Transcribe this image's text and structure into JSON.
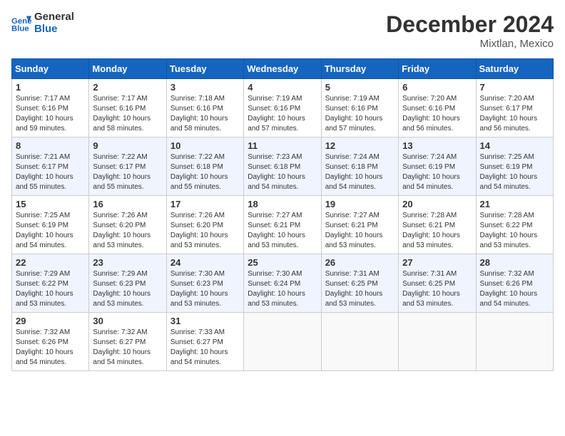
{
  "header": {
    "logo_line1": "General",
    "logo_line2": "Blue",
    "month": "December 2024",
    "location": "Mixtlan, Mexico"
  },
  "weekdays": [
    "Sunday",
    "Monday",
    "Tuesday",
    "Wednesday",
    "Thursday",
    "Friday",
    "Saturday"
  ],
  "weeks": [
    [
      {
        "day": "1",
        "sunrise": "7:17 AM",
        "sunset": "6:16 PM",
        "daylight": "10 hours and 59 minutes."
      },
      {
        "day": "2",
        "sunrise": "7:17 AM",
        "sunset": "6:16 PM",
        "daylight": "10 hours and 58 minutes."
      },
      {
        "day": "3",
        "sunrise": "7:18 AM",
        "sunset": "6:16 PM",
        "daylight": "10 hours and 58 minutes."
      },
      {
        "day": "4",
        "sunrise": "7:19 AM",
        "sunset": "6:16 PM",
        "daylight": "10 hours and 57 minutes."
      },
      {
        "day": "5",
        "sunrise": "7:19 AM",
        "sunset": "6:16 PM",
        "daylight": "10 hours and 57 minutes."
      },
      {
        "day": "6",
        "sunrise": "7:20 AM",
        "sunset": "6:16 PM",
        "daylight": "10 hours and 56 minutes."
      },
      {
        "day": "7",
        "sunrise": "7:20 AM",
        "sunset": "6:17 PM",
        "daylight": "10 hours and 56 minutes."
      }
    ],
    [
      {
        "day": "8",
        "sunrise": "7:21 AM",
        "sunset": "6:17 PM",
        "daylight": "10 hours and 55 minutes."
      },
      {
        "day": "9",
        "sunrise": "7:22 AM",
        "sunset": "6:17 PM",
        "daylight": "10 hours and 55 minutes."
      },
      {
        "day": "10",
        "sunrise": "7:22 AM",
        "sunset": "6:18 PM",
        "daylight": "10 hours and 55 minutes."
      },
      {
        "day": "11",
        "sunrise": "7:23 AM",
        "sunset": "6:18 PM",
        "daylight": "10 hours and 54 minutes."
      },
      {
        "day": "12",
        "sunrise": "7:24 AM",
        "sunset": "6:18 PM",
        "daylight": "10 hours and 54 minutes."
      },
      {
        "day": "13",
        "sunrise": "7:24 AM",
        "sunset": "6:19 PM",
        "daylight": "10 hours and 54 minutes."
      },
      {
        "day": "14",
        "sunrise": "7:25 AM",
        "sunset": "6:19 PM",
        "daylight": "10 hours and 54 minutes."
      }
    ],
    [
      {
        "day": "15",
        "sunrise": "7:25 AM",
        "sunset": "6:19 PM",
        "daylight": "10 hours and 54 minutes."
      },
      {
        "day": "16",
        "sunrise": "7:26 AM",
        "sunset": "6:20 PM",
        "daylight": "10 hours and 53 minutes."
      },
      {
        "day": "17",
        "sunrise": "7:26 AM",
        "sunset": "6:20 PM",
        "daylight": "10 hours and 53 minutes."
      },
      {
        "day": "18",
        "sunrise": "7:27 AM",
        "sunset": "6:21 PM",
        "daylight": "10 hours and 53 minutes."
      },
      {
        "day": "19",
        "sunrise": "7:27 AM",
        "sunset": "6:21 PM",
        "daylight": "10 hours and 53 minutes."
      },
      {
        "day": "20",
        "sunrise": "7:28 AM",
        "sunset": "6:21 PM",
        "daylight": "10 hours and 53 minutes."
      },
      {
        "day": "21",
        "sunrise": "7:28 AM",
        "sunset": "6:22 PM",
        "daylight": "10 hours and 53 minutes."
      }
    ],
    [
      {
        "day": "22",
        "sunrise": "7:29 AM",
        "sunset": "6:22 PM",
        "daylight": "10 hours and 53 minutes."
      },
      {
        "day": "23",
        "sunrise": "7:29 AM",
        "sunset": "6:23 PM",
        "daylight": "10 hours and 53 minutes."
      },
      {
        "day": "24",
        "sunrise": "7:30 AM",
        "sunset": "6:23 PM",
        "daylight": "10 hours and 53 minutes."
      },
      {
        "day": "25",
        "sunrise": "7:30 AM",
        "sunset": "6:24 PM",
        "daylight": "10 hours and 53 minutes."
      },
      {
        "day": "26",
        "sunrise": "7:31 AM",
        "sunset": "6:25 PM",
        "daylight": "10 hours and 53 minutes."
      },
      {
        "day": "27",
        "sunrise": "7:31 AM",
        "sunset": "6:25 PM",
        "daylight": "10 hours and 53 minutes."
      },
      {
        "day": "28",
        "sunrise": "7:32 AM",
        "sunset": "6:26 PM",
        "daylight": "10 hours and 54 minutes."
      }
    ],
    [
      {
        "day": "29",
        "sunrise": "7:32 AM",
        "sunset": "6:26 PM",
        "daylight": "10 hours and 54 minutes."
      },
      {
        "day": "30",
        "sunrise": "7:32 AM",
        "sunset": "6:27 PM",
        "daylight": "10 hours and 54 minutes."
      },
      {
        "day": "31",
        "sunrise": "7:33 AM",
        "sunset": "6:27 PM",
        "daylight": "10 hours and 54 minutes."
      },
      null,
      null,
      null,
      null
    ]
  ]
}
